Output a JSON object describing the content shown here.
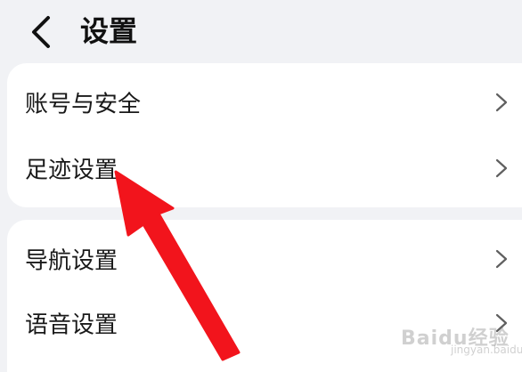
{
  "header": {
    "back_icon": "chevron-left-icon",
    "title": "设置"
  },
  "groups": [
    {
      "items": [
        {
          "label": "账号与安全",
          "icon": "chevron-right-icon"
        },
        {
          "label": "足迹设置",
          "icon": "chevron-right-icon"
        }
      ]
    },
    {
      "items": [
        {
          "label": "导航设置",
          "icon": "chevron-right-icon"
        },
        {
          "label": "语音设置",
          "icon": "chevron-right-icon"
        }
      ]
    }
  ],
  "annotation": {
    "color": "#f2141c",
    "points_to": "足迹设置"
  },
  "watermark": {
    "logo_text": "Baidu经验",
    "sub_text": "jingyan.baidu.com"
  },
  "colors": {
    "background": "#f1f2f5",
    "card": "#ffffff",
    "text": "#191919",
    "chevron": "#5f5f5f"
  }
}
